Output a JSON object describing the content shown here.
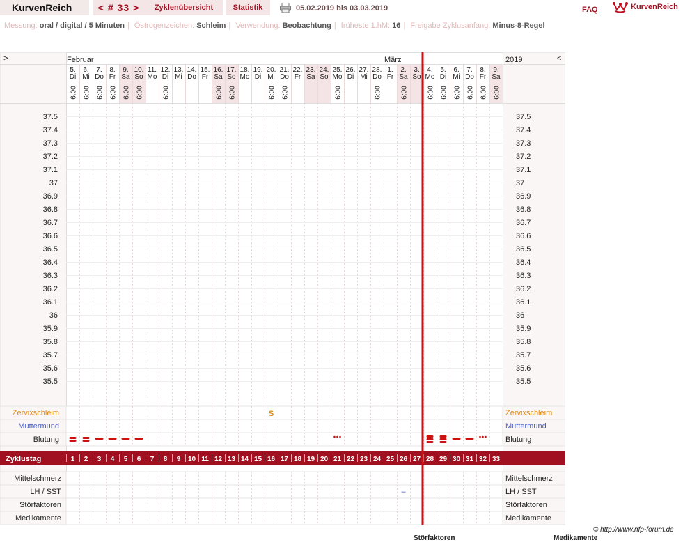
{
  "header": {
    "brand": "KurvenReich",
    "cycle_nav": "< # 33 >",
    "cycles_overview": "Zyklenübersicht",
    "statistics": "Statistik",
    "date_range": "05.02.2019 bis 03.03.2019",
    "faq": "FAQ",
    "logo_text": "KurvenReich"
  },
  "info": {
    "items": [
      {
        "label": "Messung:",
        "value": "oral / digital / 5 Minuten"
      },
      {
        "label": "Östrogenzeichen:",
        "value": "Schleim"
      },
      {
        "label": "Verwendung:",
        "value": "Beobachtung"
      },
      {
        "label": "früheste 1.hM:",
        "value": "16"
      },
      {
        "label": "Freigabe Zyklusanfang:",
        "value": "Minus-8-Regel"
      }
    ]
  },
  "chart": {
    "nav_prev": ">",
    "nav_next": "<",
    "year": "2019",
    "month_start": "Februar",
    "month_second": "März",
    "days": [
      {
        "d": "5.",
        "w": "Di",
        "t": "6:00",
        "we": false
      },
      {
        "d": "6.",
        "w": "Mi",
        "t": "6:00",
        "we": false
      },
      {
        "d": "7.",
        "w": "Do",
        "t": "6:00",
        "we": false
      },
      {
        "d": "8.",
        "w": "Fr",
        "t": "6:00",
        "we": false
      },
      {
        "d": "9.",
        "w": "Sa",
        "t": "6:00",
        "we": true
      },
      {
        "d": "10.",
        "w": "So",
        "t": "6:00",
        "we": true
      },
      {
        "d": "11.",
        "w": "Mo",
        "t": "",
        "we": false
      },
      {
        "d": "12.",
        "w": "Di",
        "t": "6:00",
        "we": false
      },
      {
        "d": "13.",
        "w": "Mi",
        "t": "",
        "we": false
      },
      {
        "d": "14.",
        "w": "Do",
        "t": "",
        "we": false
      },
      {
        "d": "15.",
        "w": "Fr",
        "t": "",
        "we": false
      },
      {
        "d": "16.",
        "w": "Sa",
        "t": "6:00",
        "we": true
      },
      {
        "d": "17.",
        "w": "So",
        "t": "6:00",
        "we": true
      },
      {
        "d": "18.",
        "w": "Mo",
        "t": "",
        "we": false
      },
      {
        "d": "19.",
        "w": "Di",
        "t": "",
        "we": false
      },
      {
        "d": "20.",
        "w": "Mi",
        "t": "6:00",
        "we": false
      },
      {
        "d": "21.",
        "w": "Do",
        "t": "6:00",
        "we": false
      },
      {
        "d": "22.",
        "w": "Fr",
        "t": "",
        "we": false
      },
      {
        "d": "23.",
        "w": "Sa",
        "t": "",
        "we": true
      },
      {
        "d": "24.",
        "w": "So",
        "t": "",
        "we": true
      },
      {
        "d": "25.",
        "w": "Mo",
        "t": "6:00",
        "we": false
      },
      {
        "d": "26.",
        "w": "Di",
        "t": "",
        "we": false
      },
      {
        "d": "27.",
        "w": "Mi",
        "t": "",
        "we": false
      },
      {
        "d": "28.",
        "w": "Do",
        "t": "6:00",
        "we": false
      },
      {
        "d": "1.",
        "w": "Fr",
        "t": "",
        "we": false
      },
      {
        "d": "2.",
        "w": "Sa",
        "t": "6:00",
        "we": true
      },
      {
        "d": "3.",
        "w": "So",
        "t": "",
        "we": true
      },
      {
        "d": "4.",
        "w": "Mo",
        "t": "6:00",
        "we": false
      },
      {
        "d": "5.",
        "w": "Di",
        "t": "6:00",
        "we": false
      },
      {
        "d": "6.",
        "w": "Mi",
        "t": "6:00",
        "we": false
      },
      {
        "d": "7.",
        "w": "Do",
        "t": "6:00",
        "we": false
      },
      {
        "d": "8.",
        "w": "Fr",
        "t": "6:00",
        "we": false
      },
      {
        "d": "9.",
        "w": "Sa",
        "t": "6:00",
        "we": true
      }
    ],
    "temps": [
      "37.5",
      "37.4",
      "37.3",
      "37.2",
      "37.1",
      "37",
      "36.9",
      "36.8",
      "36.7",
      "36.6",
      "36.5",
      "36.4",
      "36.3",
      "36.2",
      "36.1",
      "36",
      "35.9",
      "35.8",
      "35.7",
      "35.6",
      "35.5"
    ],
    "rows": {
      "cervix": "Zervixschleim",
      "cervix_os": "Muttermund",
      "bleeding": "Blutung",
      "cycle_day": "Zyklustag",
      "ovulation_pain": "Mittelschmerz",
      "lh": "LH / SST",
      "disturbances": "Störfaktoren",
      "medication": "Medikamente"
    },
    "mucus_mark": {
      "day": 16,
      "symbol": "S"
    },
    "bleeding": [
      {
        "day": 1,
        "level": "heavy"
      },
      {
        "day": 2,
        "level": "heavy"
      },
      {
        "day": 3,
        "level": "medium"
      },
      {
        "day": 4,
        "level": "medium"
      },
      {
        "day": 5,
        "level": "medium"
      },
      {
        "day": 6,
        "level": "medium"
      },
      {
        "day": 21,
        "level": "spotting"
      },
      {
        "day": 28,
        "level": "very-heavy"
      },
      {
        "day": 29,
        "level": "very-heavy"
      },
      {
        "day": 30,
        "level": "medium"
      },
      {
        "day": 31,
        "level": "medium"
      },
      {
        "day": 32,
        "level": "spotting"
      }
    ],
    "lh_mark": {
      "day": 26,
      "symbol": "–"
    },
    "cycle_boundary_day": 28,
    "colors": {
      "accent": "#a01020",
      "weekend": "#f4e4e6",
      "side": "#fbf4f4",
      "mucus": "#e08a10",
      "muttermund": "#4a5cc4",
      "boundary": "#cc1111"
    }
  },
  "footer": {
    "credit": "© http://www.nfp-forum.de",
    "cut_left": "Störfaktoren",
    "cut_right": "Medikamente"
  }
}
